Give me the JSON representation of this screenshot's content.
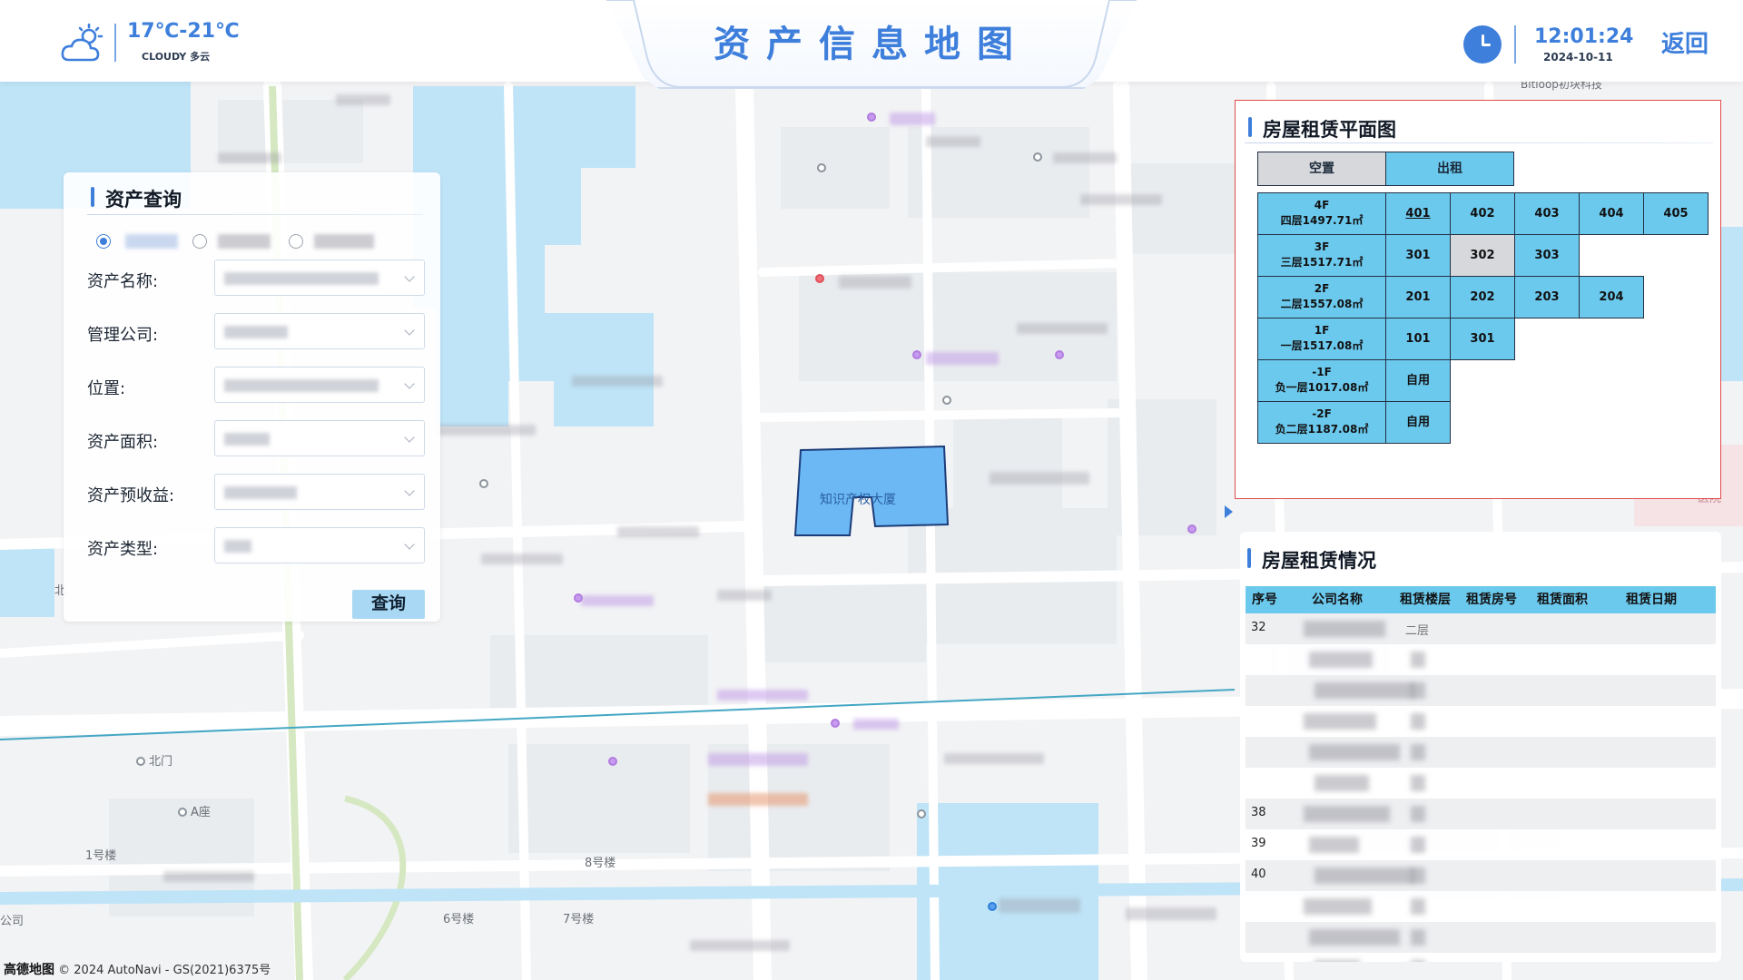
{
  "header": {
    "title": "资产信息地图",
    "weather": {
      "temperature": "17℃-21℃",
      "description": "CLOUDY 多云",
      "icon": "cloud-sun-icon"
    },
    "clock": {
      "time": "12:01:24",
      "date": "2024-10-11",
      "icon": "clock-icon"
    },
    "back_label": "返回"
  },
  "colors": {
    "accent": "#3e7fdc",
    "rented": "#6cc9ee",
    "vacant": "#d6d8db",
    "building": "#6bb8f5",
    "water": "#bfe4f7"
  },
  "query": {
    "title": "资产查询",
    "radio_selected_index": 0,
    "radio_count": 3,
    "fields": [
      {
        "label": "资产名称:"
      },
      {
        "label": "管理公司:"
      },
      {
        "label": "位置:"
      },
      {
        "label": "资产面积:"
      },
      {
        "label": "资产预收益:"
      },
      {
        "label": "资产类型:"
      }
    ],
    "submit_label": "查询"
  },
  "plan": {
    "title": "房屋租赁平面图",
    "legend": {
      "vacant": "空置",
      "rented": "出租"
    },
    "floors": [
      {
        "code": "4F",
        "area": "四层1497.71㎡",
        "rooms": [
          {
            "no": "401",
            "vacant": false,
            "underline": true
          },
          {
            "no": "402",
            "vacant": false
          },
          {
            "no": "403",
            "vacant": false
          },
          {
            "no": "404",
            "vacant": false
          },
          {
            "no": "405",
            "vacant": false
          }
        ]
      },
      {
        "code": "3F",
        "area": "三层1517.71㎡",
        "rooms": [
          {
            "no": "301",
            "vacant": false
          },
          {
            "no": "302",
            "vacant": true
          },
          {
            "no": "303",
            "vacant": false
          }
        ]
      },
      {
        "code": "2F",
        "area": "二层1557.08㎡",
        "rooms": [
          {
            "no": "201",
            "vacant": false
          },
          {
            "no": "202",
            "vacant": false
          },
          {
            "no": "203",
            "vacant": false
          },
          {
            "no": "204",
            "vacant": false
          }
        ]
      },
      {
        "code": "1F",
        "area": "一层1517.08㎡",
        "rooms": [
          {
            "no": "101",
            "vacant": false
          },
          {
            "no": "301",
            "vacant": false
          }
        ]
      },
      {
        "code": "-1F",
        "area": "负一层1017.08㎡",
        "rooms": [
          {
            "no": "自用",
            "vacant": false
          }
        ]
      },
      {
        "code": "-2F",
        "area": "负二层1187.08㎡",
        "rooms": [
          {
            "no": "自用",
            "vacant": false
          }
        ]
      }
    ]
  },
  "rental": {
    "title": "房屋租赁情况",
    "columns": [
      "序号",
      "公司名称",
      "租赁楼层",
      "租赁房号",
      "租赁面积",
      "租赁日期"
    ],
    "rows": [
      {
        "seq": "32",
        "floor": "二层"
      },
      {
        "seq": ""
      },
      {
        "seq": ""
      },
      {
        "seq": ""
      },
      {
        "seq": ""
      },
      {
        "seq": ""
      },
      {
        "seq": "38"
      },
      {
        "seq": "39"
      },
      {
        "seq": "40"
      },
      {
        "seq": ""
      },
      {
        "seq": ""
      },
      {
        "seq": ""
      }
    ]
  },
  "map": {
    "labels": [
      "北门",
      "A座",
      "1号楼",
      "8号楼",
      "6号楼",
      "7号楼",
      "知识产权大厦",
      "Bitloop初块科技",
      "高德地图",
      "© 2024 AutoNavi - GS(2021)6375号",
      "医院",
      "公司",
      "北"
    ],
    "highlight_building": "知识产权大厦"
  }
}
